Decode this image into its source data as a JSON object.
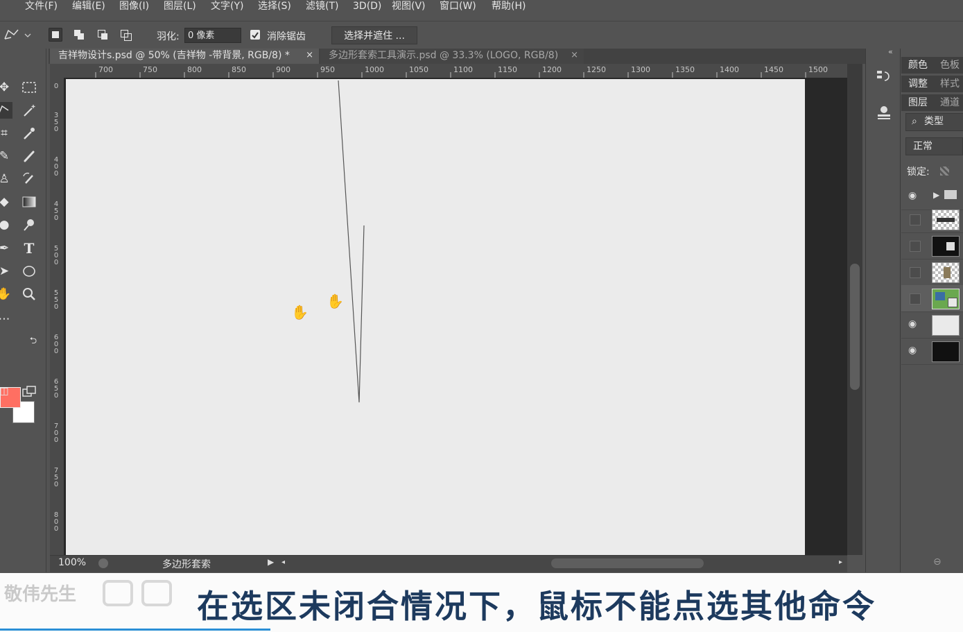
{
  "menubar": {
    "items": [
      "文件(F)",
      "编辑(E)",
      "图像(I)",
      "图层(L)",
      "文字(Y)",
      "选择(S)",
      "滤镜(T)",
      "3D(D)",
      "视图(V)",
      "窗口(W)",
      "帮助(H)"
    ]
  },
  "options": {
    "feather_label": "羽化:",
    "feather_value": "0 像素",
    "antialias_label": "消除锯齿",
    "select_mask_label": "选择并遮住 ..."
  },
  "tabs": [
    {
      "label": "吉祥物设计s.psd @ 50% (吉祥物 -带背景, RGB/8) *",
      "close": "×"
    },
    {
      "label": "多边形套索工具演示.psd @ 33.3% (LOGO, RGB/8)",
      "close": "×"
    }
  ],
  "ruler": {
    "top_ticks": [
      "700",
      "750",
      "800",
      "850",
      "900",
      "950",
      "1000",
      "1050",
      "1100",
      "1150",
      "1200",
      "1250",
      "1300",
      "1350",
      "1400",
      "1450",
      "1500"
    ],
    "left_ticks": [
      "0",
      "350",
      "400",
      "450",
      "500",
      "550",
      "600",
      "650",
      "700",
      "750",
      "800"
    ]
  },
  "status": {
    "zoom": "100%",
    "tool_name": "多边形套索"
  },
  "colors": {
    "foreground": "#ff6f62",
    "background": "#ffffff",
    "subtitle": "#1d3a5e"
  },
  "panels": {
    "tab_color": "颜色",
    "tab_swatches": "色板",
    "tab_adjust": "调整",
    "tab_styles": "样式",
    "tab_layers": "图层",
    "tab_channels": "通道",
    "filter_label": "类型",
    "blend_mode": "正常",
    "lock_label": "锁定:"
  },
  "subtitle": {
    "text": "在选区未闭合情况下，鼠标不能点选其他命令",
    "logo": "敬伟先生"
  }
}
